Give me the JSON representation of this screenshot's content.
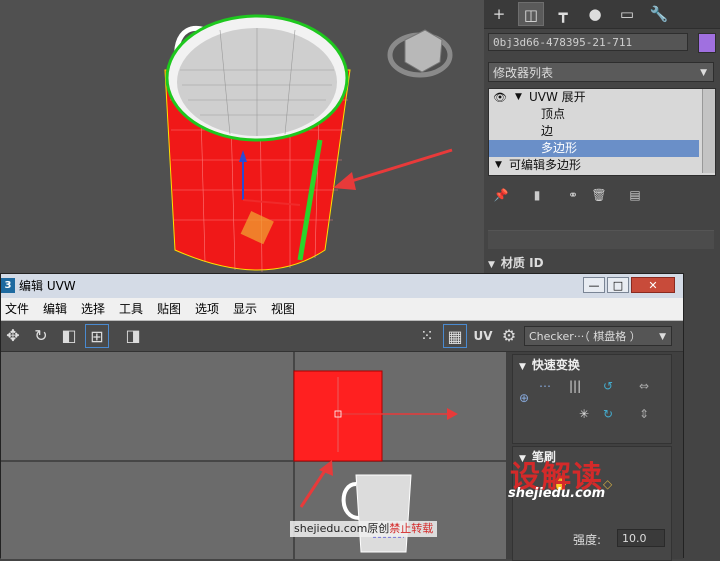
{
  "command_panel": {
    "tabs": [
      "create-icon",
      "modify-icon",
      "hierarchy-icon",
      "motion-icon",
      "display-icon",
      "utilities-icon"
    ],
    "object_name": "0bj3d66-478395-21-711",
    "object_color": "#a070e0",
    "modifier_list_label": "修改器列表",
    "stack": [
      {
        "label": "UVW 展开",
        "level": 0,
        "eye": true,
        "expanded": true
      },
      {
        "label": "顶点",
        "level": 1
      },
      {
        "label": "边",
        "level": 1
      },
      {
        "label": "多边形",
        "level": 1,
        "selected": true
      },
      {
        "label": "可编辑多边形",
        "level": 0,
        "expanded": false
      }
    ],
    "material_id_rollout": "材质 ID"
  },
  "uvw_window": {
    "app_icon": "3",
    "title": "编辑 UVW",
    "window_buttons": {
      "minimize": "—",
      "maximize": "□",
      "close": "✕"
    },
    "menu": [
      "文件",
      "编辑",
      "选择",
      "工具",
      "贴图",
      "选项",
      "显示",
      "视图"
    ],
    "toolbar_uv_label": "UV",
    "checker_label": "Checker···（ 棋盘格 ）",
    "quick_transform_title": "快速变换",
    "brush_title": "笔刷",
    "strength_label": "强度:",
    "strength_value": "10.0"
  },
  "watermark": {
    "logo": "设解读",
    "site": "shejiedu.com",
    "bottom_text": "shejiedu.com原创",
    "bottom_red": "禁止转载"
  },
  "colors": {
    "uv_red": "#ff2020",
    "accent_blue": "#6a8fc8",
    "annotation_red": "#e83a3a"
  }
}
